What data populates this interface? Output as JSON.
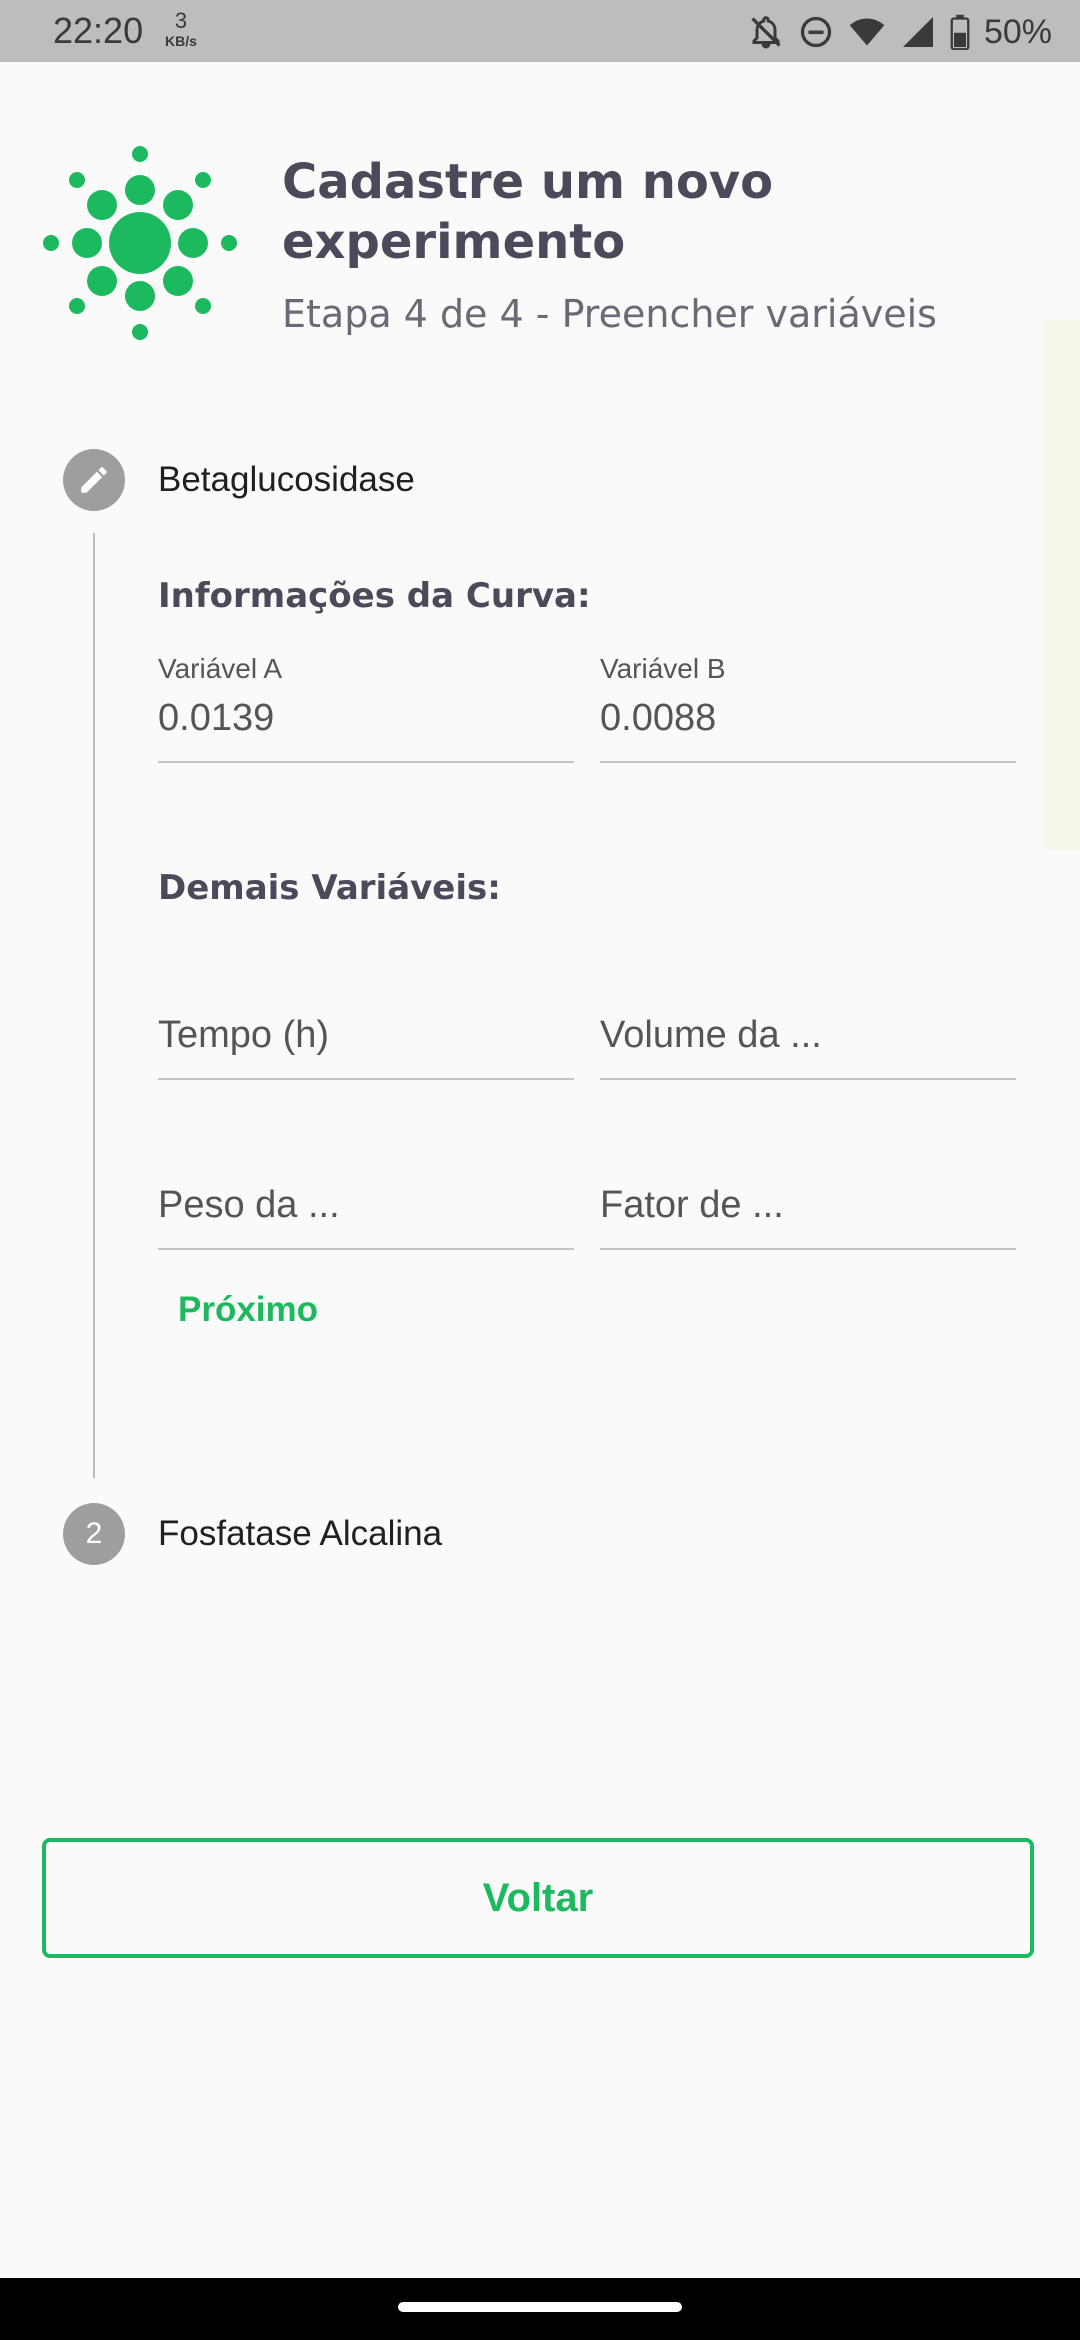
{
  "status_bar": {
    "time": "22:20",
    "net_speed": "3",
    "net_unit": "KB/s",
    "icons": [
      "notifications-off-icon",
      "do-not-disturb-icon",
      "wifi-icon",
      "signal-icon",
      "battery-icon"
    ],
    "battery": "50%"
  },
  "header": {
    "title": "Cadastre um novo experimento",
    "subtitle": "Etapa 4 de 4 - Preencher variáveis"
  },
  "steps": [
    {
      "label": "Betaglucosidase",
      "state": "editing",
      "curve_heading": "Informações da Curva:",
      "variable_a_label": "Variável A",
      "variable_a_value": "0.0139",
      "variable_b_label": "Variável B",
      "variable_b_value": "0.0088",
      "other_heading": "Demais Variáveis:",
      "fields": {
        "tempo": "Tempo (h)",
        "volume": "Volume da ...",
        "peso": "Peso da ...",
        "fator": "Fator de ..."
      },
      "next_label": "Próximo"
    },
    {
      "number": "2",
      "label": "Fosfatase Alcalina"
    }
  ],
  "back_label": "Voltar",
  "colors": {
    "accent": "#1db95e",
    "title": "#4a4a5a",
    "step_inactive": "#9e9e9e"
  }
}
